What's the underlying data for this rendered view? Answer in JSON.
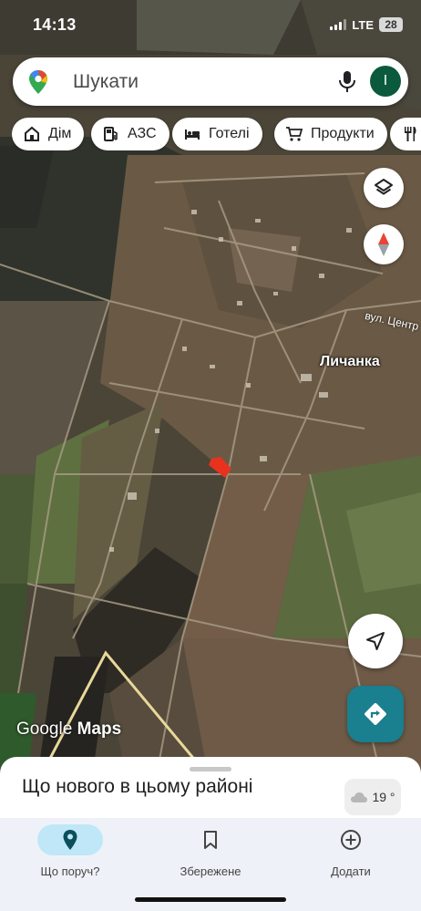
{
  "status_bar": {
    "time": "14:13",
    "network": "LTE",
    "battery": "28"
  },
  "search": {
    "placeholder": "Шукати",
    "avatar_letter": "I",
    "logo_icon": "google-maps-pin-icon",
    "mic_icon": "microphone-icon"
  },
  "chips": [
    {
      "label": "Дім",
      "icon": "home-icon"
    },
    {
      "label": "АЗС",
      "icon": "fuel-icon"
    },
    {
      "label": "Готелі",
      "icon": "bed-icon"
    },
    {
      "label": "Продукти",
      "icon": "cart-icon"
    },
    {
      "label": "",
      "icon": "restaurant-icon"
    }
  ],
  "map": {
    "place_label": "Личанка",
    "street_label": "вул. Центр",
    "watermark_google": "Google",
    "watermark_maps": "Maps",
    "layers_icon": "layers-icon",
    "compass_icon": "compass-icon",
    "locate_icon": "navigation-arrow-icon",
    "directions_icon": "directions-icon"
  },
  "sheet": {
    "title": "Що нового в цьому районі",
    "temperature": "19 °",
    "weather_icon": "cloud-icon"
  },
  "bottom_nav": {
    "items": [
      {
        "label": "Що поруч?",
        "icon": "place-pin-icon",
        "active": true
      },
      {
        "label": "Збережене",
        "icon": "bookmark-icon",
        "active": false
      },
      {
        "label": "Додати",
        "icon": "add-circle-icon",
        "active": false
      }
    ]
  },
  "colors": {
    "accent_teal": "#1a7f8e",
    "avatar_green": "#0b5a3e",
    "active_pill": "#bfe7f7",
    "highlight_plot": "#e8321e"
  }
}
